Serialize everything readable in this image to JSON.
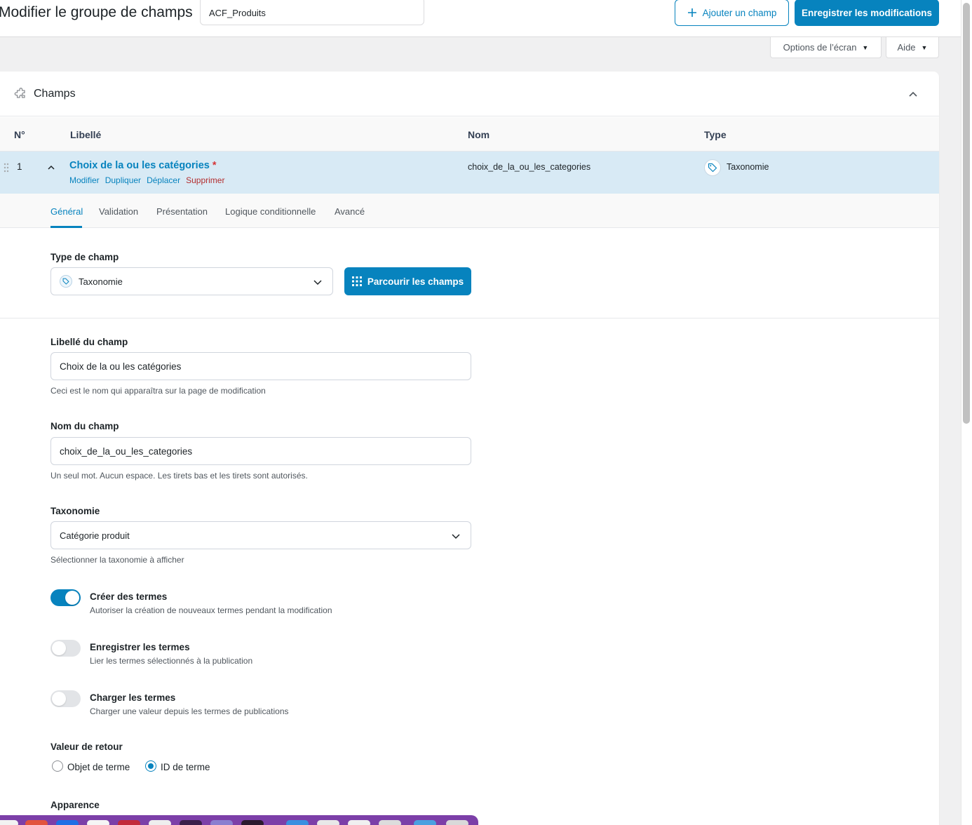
{
  "header": {
    "title": "Modifier le groupe de champs",
    "group_name": "ACF_Produits",
    "add_field": "Ajouter un champ",
    "save": "Enregistrer les modifications",
    "screen_options": "Options de l’écran",
    "help": "Aide"
  },
  "panel": {
    "title": "Champs",
    "columns": {
      "num": "N°",
      "label": "Libellé",
      "name": "Nom",
      "type": "Type"
    }
  },
  "field": {
    "num": "1",
    "label": "Choix de la ou les catégories",
    "required_mark": "*",
    "actions": {
      "edit": "Modifier",
      "duplicate": "Dupliquer",
      "move": "Déplacer",
      "delete": "Supprimer"
    },
    "name": "choix_de_la_ou_les_categories",
    "type": "Taxonomie"
  },
  "tabs": [
    "Général",
    "Validation",
    "Présentation",
    "Logique conditionnelle",
    "Avancé"
  ],
  "settings": {
    "field_type_label": "Type de champ",
    "field_type_value": "Taxonomie",
    "browse_fields": "Parcourir les champs",
    "field_label_label": "Libellé du champ",
    "field_label_value": "Choix de la ou les catégories",
    "field_label_help": "Ceci est le nom qui apparaîtra sur la page de modification",
    "field_name_label": "Nom du champ",
    "field_name_value": "choix_de_la_ou_les_categories",
    "field_name_help": "Un seul mot. Aucun espace. Les tirets bas et les tirets sont autorisés.",
    "taxonomy_label": "Taxonomie",
    "taxonomy_value": "Catégorie produit",
    "taxonomy_help": "Sélectionner la taxonomie à afficher",
    "toggles": [
      {
        "title": "Créer des termes",
        "desc": "Autoriser la création de nouveaux termes pendant la modification",
        "on": true
      },
      {
        "title": "Enregistrer les termes",
        "desc": "Lier les termes sélectionnés à la publication",
        "on": false
      },
      {
        "title": "Charger les termes",
        "desc": "Charger une valeur depuis les termes de publications",
        "on": false
      }
    ],
    "return_value_label": "Valeur de retour",
    "return_options": [
      "Objet de terme",
      "ID de terme"
    ],
    "return_selected": "ID de terme",
    "appearance_label": "Apparence"
  },
  "colors": {
    "accent": "#0783be",
    "danger": "#b32d2e",
    "row_active": "#d8eaf5"
  }
}
